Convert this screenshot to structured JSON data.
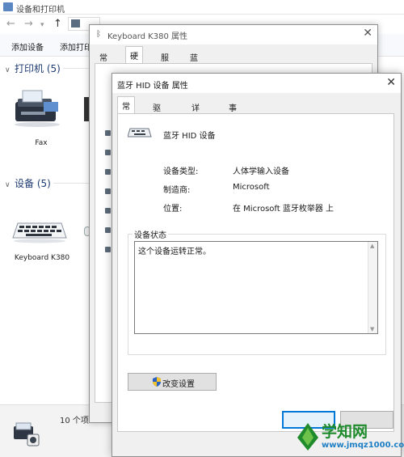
{
  "explorer": {
    "title": "设备和打印机",
    "toolbar": {
      "add_device": "添加设备",
      "add_printer": "添加打印"
    },
    "sections": [
      {
        "label": "打印机 (5)"
      },
      {
        "label": "设备 (5)"
      }
    ],
    "devices": {
      "fax_label": "Fax",
      "keyboard_label": "Keyboard K380"
    },
    "status_count": "10 个项"
  },
  "dialog_keyboard": {
    "title": "Keyboard K380 属性",
    "tabs": [
      "常规",
      "硬件",
      "服务",
      "蓝牙"
    ],
    "active_tab": "硬件"
  },
  "dialog_hid": {
    "title": "蓝牙 HID 设备 属性",
    "tabs": [
      "常规",
      "驱动程序",
      "详细信息",
      "事件"
    ],
    "active_tab": "常规",
    "device_name": "蓝牙 HID 设备",
    "props": {
      "type_label": "设备类型:",
      "type_value": "人体学输入设备",
      "mfr_label": "制造商:",
      "mfr_value": "Microsoft",
      "loc_label": "位置:",
      "loc_value": "在 Microsoft 蓝牙枚举器 上"
    },
    "status_group_label": "设备状态",
    "status_text": "这个设备运转正常。",
    "change_settings_label": "改变设置"
  },
  "watermark": {
    "text": "学知网",
    "url": "www.jmqz1000.com"
  },
  "colors": {
    "accent": "#0078d7",
    "section": "#1e3b72",
    "watermark_green": "#1f8b2c"
  }
}
